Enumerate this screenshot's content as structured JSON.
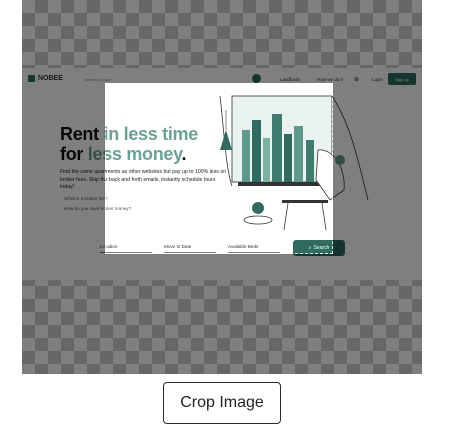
{
  "screenshot": {
    "brand": "NOBEE",
    "nav": {
      "search_placeholder": "Search a place",
      "link_1": "Landlords",
      "link_2": "How we do it",
      "language_icon": "globe-icon",
      "login": "Login",
      "signup": "Sign up"
    },
    "hero": {
      "title_1": "Rent ",
      "title_2": "in ",
      "title_3": "less time",
      "title_4": "for ",
      "title_5": "less money",
      "title_6": ".",
      "description": "Find the same apartments as other websites but pay up to 100% less on broker fees. Skip the back and forth emails, instantly schedule tours today!",
      "question_1": "What is a broker fee?",
      "question_2": "How do you save broker money?"
    },
    "form": {
      "location_label": "Location",
      "move_in_label": "Move In Date",
      "bedrooms_label": "Available Beds",
      "search_button": "Search"
    },
    "colors": {
      "brand": "#2f6b5e",
      "accent": "#6aa395"
    }
  },
  "actions": {
    "crop_button": "Crop Image"
  }
}
